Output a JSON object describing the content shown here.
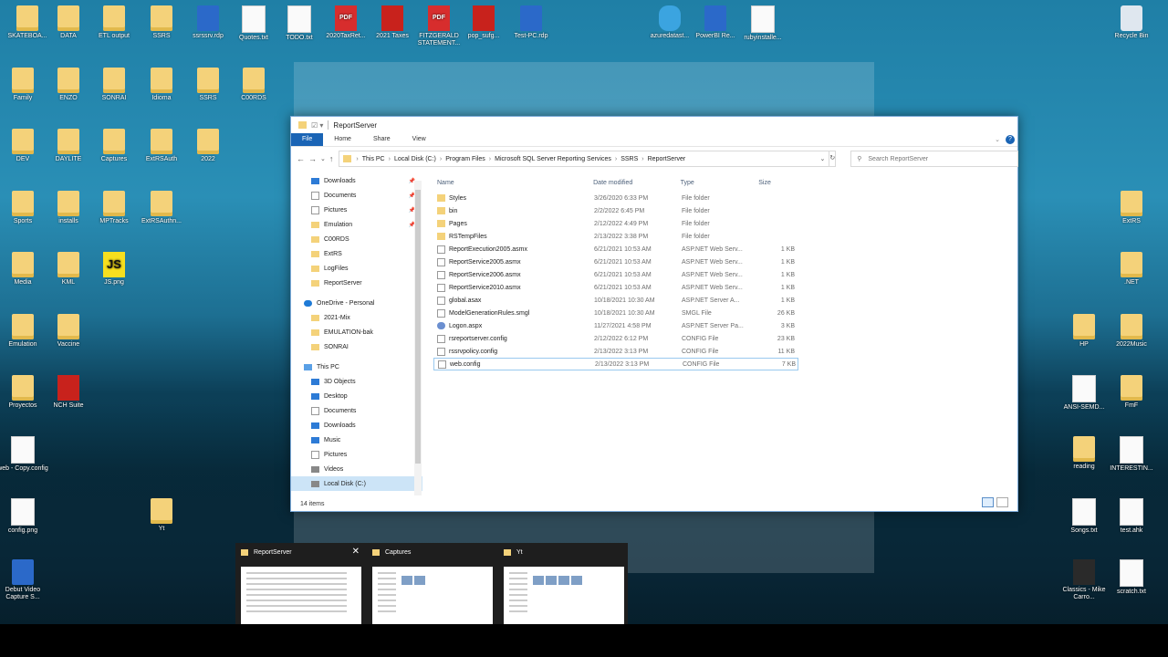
{
  "desktop_icons": [
    {
      "label": "SKATEBOA...",
      "kind": "folder"
    },
    {
      "label": "DATA",
      "kind": "folder"
    },
    {
      "label": "ETL output",
      "kind": "folder"
    },
    {
      "label": "SSRS",
      "kind": "folder"
    },
    {
      "label": "ssrssrv.rdp",
      "kind": "monitor"
    },
    {
      "label": "Quotes.txt",
      "kind": "doc"
    },
    {
      "label": "TODO.txt",
      "kind": "doc"
    },
    {
      "label": "2020TaxRet...",
      "kind": "pdf"
    },
    {
      "label": "2021 Taxes",
      "kind": "red"
    },
    {
      "label": "FITZGERALD STATEMENT...",
      "kind": "pdf"
    },
    {
      "label": "pop_sufg...",
      "kind": "red"
    },
    {
      "label": "Test-PC.rdp",
      "kind": "monitor"
    },
    {
      "label": "azuredatast...",
      "kind": "cloud"
    },
    {
      "label": "PowerBI Re...",
      "kind": "monitor"
    },
    {
      "label": "rubyinstalle...",
      "kind": "doc"
    },
    {
      "label": "Recycle Bin",
      "kind": "bin"
    },
    {
      "label": "Family",
      "kind": "folder"
    },
    {
      "label": "ENZO",
      "kind": "folder"
    },
    {
      "label": "SONRAI",
      "kind": "folder"
    },
    {
      "label": "Idioma",
      "kind": "folder"
    },
    {
      "label": "SSRS",
      "kind": "folder"
    },
    {
      "label": "C00RDS",
      "kind": "folder"
    },
    {
      "label": "DEV",
      "kind": "folder"
    },
    {
      "label": "DAYLITE",
      "kind": "folder"
    },
    {
      "label": "Captures",
      "kind": "folder"
    },
    {
      "label": "ExtRSAuth",
      "kind": "folder"
    },
    {
      "label": "2022",
      "kind": "folder"
    },
    {
      "label": "Sports",
      "kind": "folder"
    },
    {
      "label": "installs",
      "kind": "folder"
    },
    {
      "label": "MPTracks",
      "kind": "folder"
    },
    {
      "label": "ExtRSAuthn...",
      "kind": "folder"
    },
    {
      "label": "ExtRS",
      "kind": "folder"
    },
    {
      "label": "Media",
      "kind": "folder"
    },
    {
      "label": "KML",
      "kind": "folder"
    },
    {
      "label": "JS.png",
      "kind": "js"
    },
    {
      ".NET": ".NET",
      "label": ".NET",
      "kind": "folder"
    },
    {
      "label": "Emulation",
      "kind": "folder"
    },
    {
      "label": "Vaccine",
      "kind": "folder"
    },
    {
      "label": "HP",
      "kind": "folder"
    },
    {
      "label": "2022Music",
      "kind": "folder"
    },
    {
      "label": "Proyectos",
      "kind": "folder"
    },
    {
      "label": "NCH Suite",
      "kind": "red"
    },
    {
      "label": "ANSI-SEMD...",
      "kind": "doc"
    },
    {
      "label": "FmF",
      "kind": "folder"
    },
    {
      "label": "web - Copy.config",
      "kind": "doc"
    },
    {
      "label": "reading",
      "kind": "folder"
    },
    {
      "label": "INTERESTIN...",
      "kind": "doc"
    },
    {
      "label": "config.png",
      "kind": "doc"
    },
    {
      "label": "Yt",
      "kind": "folder"
    },
    {
      "label": "Songs.txt",
      "kind": "doc"
    },
    {
      "label": "test.ahk",
      "kind": "doc"
    },
    {
      "label": "Debut Video Capture S...",
      "kind": "monitor"
    },
    {
      "label": "Classics - Mike Carro...",
      "kind": "dark"
    },
    {
      "label": "scratch.txt",
      "kind": "doc"
    }
  ],
  "explorer": {
    "title": "ReportServer",
    "ribbon_tabs": [
      "File",
      "Home",
      "Share",
      "View"
    ],
    "breadcrumb": [
      "This PC",
      "Local Disk (C:)",
      "Program Files",
      "Microsoft SQL Server Reporting Services",
      "SSRS",
      "ReportServer"
    ],
    "search_placeholder": "Search ReportServer",
    "nav": [
      {
        "label": "Downloads",
        "icon": "blue",
        "pin": true,
        "top": false
      },
      {
        "label": "Documents",
        "icon": "file",
        "pin": true,
        "top": false
      },
      {
        "label": "Pictures",
        "icon": "file",
        "pin": true,
        "top": false
      },
      {
        "label": "Emulation",
        "icon": "folder",
        "pin": true,
        "top": false
      },
      {
        "label": "C00RDS",
        "icon": "folder",
        "pin": false,
        "top": false
      },
      {
        "label": "ExtRS",
        "icon": "folder",
        "pin": false,
        "top": false
      },
      {
        "label": "LogFiles",
        "icon": "folder",
        "pin": false,
        "top": false
      },
      {
        "label": "ReportServer",
        "icon": "folder",
        "pin": false,
        "top": false
      },
      {
        "label": "",
        "icon": "",
        "pin": false,
        "top": false,
        "spacer": true
      },
      {
        "label": "OneDrive - Personal",
        "icon": "cloud",
        "pin": false,
        "top": true
      },
      {
        "label": "2021-Mix",
        "icon": "folder",
        "pin": false,
        "top": false
      },
      {
        "label": "EMULATION-bak",
        "icon": "folder",
        "pin": false,
        "top": false
      },
      {
        "label": "SONRAI",
        "icon": "folder",
        "pin": false,
        "top": false
      },
      {
        "label": "",
        "icon": "",
        "pin": false,
        "top": false,
        "spacer": true
      },
      {
        "label": "This PC",
        "icon": "pc",
        "pin": false,
        "top": true
      },
      {
        "label": "3D Objects",
        "icon": "blue",
        "pin": false,
        "top": false
      },
      {
        "label": "Desktop",
        "icon": "blue",
        "pin": false,
        "top": false
      },
      {
        "label": "Documents",
        "icon": "file",
        "pin": false,
        "top": false
      },
      {
        "label": "Downloads",
        "icon": "blue",
        "pin": false,
        "top": false
      },
      {
        "label": "Music",
        "icon": "blue",
        "pin": false,
        "top": false
      },
      {
        "label": "Pictures",
        "icon": "file",
        "pin": false,
        "top": false
      },
      {
        "label": "Videos",
        "icon": "drive",
        "pin": false,
        "top": false
      },
      {
        "label": "Local Disk (C:)",
        "icon": "drive",
        "pin": false,
        "top": false,
        "selected": true
      }
    ],
    "columns": [
      "Name",
      "Date modified",
      "Type",
      "Size"
    ],
    "files": [
      {
        "name": "Styles",
        "date": "3/26/2020 6:33 PM",
        "type": "File folder",
        "size": "",
        "icon": "folder"
      },
      {
        "name": "bin",
        "date": "2/2/2022 6:45 PM",
        "type": "File folder",
        "size": "",
        "icon": "folder"
      },
      {
        "name": "Pages",
        "date": "2/12/2022 4:49 PM",
        "type": "File folder",
        "size": "",
        "icon": "folder"
      },
      {
        "name": "RSTempFiles",
        "date": "2/13/2022 3:38 PM",
        "type": "File folder",
        "size": "",
        "icon": "folder"
      },
      {
        "name": "ReportExecution2005.asmx",
        "date": "6/21/2021 10:53 AM",
        "type": "ASP.NET Web Serv...",
        "size": "1 KB",
        "icon": "file"
      },
      {
        "name": "ReportService2005.asmx",
        "date": "6/21/2021 10:53 AM",
        "type": "ASP.NET Web Serv...",
        "size": "1 KB",
        "icon": "file"
      },
      {
        "name": "ReportService2006.asmx",
        "date": "6/21/2021 10:53 AM",
        "type": "ASP.NET Web Serv...",
        "size": "1 KB",
        "icon": "file"
      },
      {
        "name": "ReportService2010.asmx",
        "date": "6/21/2021 10:53 AM",
        "type": "ASP.NET Web Serv...",
        "size": "1 KB",
        "icon": "file"
      },
      {
        "name": "global.asax",
        "date": "10/18/2021 10:30 AM",
        "type": "ASP.NET Server A...",
        "size": "1 KB",
        "icon": "file"
      },
      {
        "name": "ModelGenerationRules.smgl",
        "date": "10/18/2021 10:30 AM",
        "type": "SMGL File",
        "size": "26 KB",
        "icon": "file"
      },
      {
        "name": "Logon.aspx",
        "date": "11/27/2021 4:58 PM",
        "type": "ASP.NET Server Pa...",
        "size": "3 KB",
        "icon": "asp"
      },
      {
        "name": "rsreportserver.config",
        "date": "2/12/2022 6:12 PM",
        "type": "CONFIG File",
        "size": "23 KB",
        "icon": "file"
      },
      {
        "name": "rssrvpolicy.config",
        "date": "2/13/2022 3:13 PM",
        "type": "CONFIG File",
        "size": "11 KB",
        "icon": "file"
      },
      {
        "name": "web.config",
        "date": "2/13/2022 3:13 PM",
        "type": "CONFIG File",
        "size": "7 KB",
        "icon": "file",
        "selected": true
      }
    ],
    "status": "14 items"
  },
  "task_thumbnails": [
    "ReportServer",
    "Captures",
    "Yt"
  ]
}
